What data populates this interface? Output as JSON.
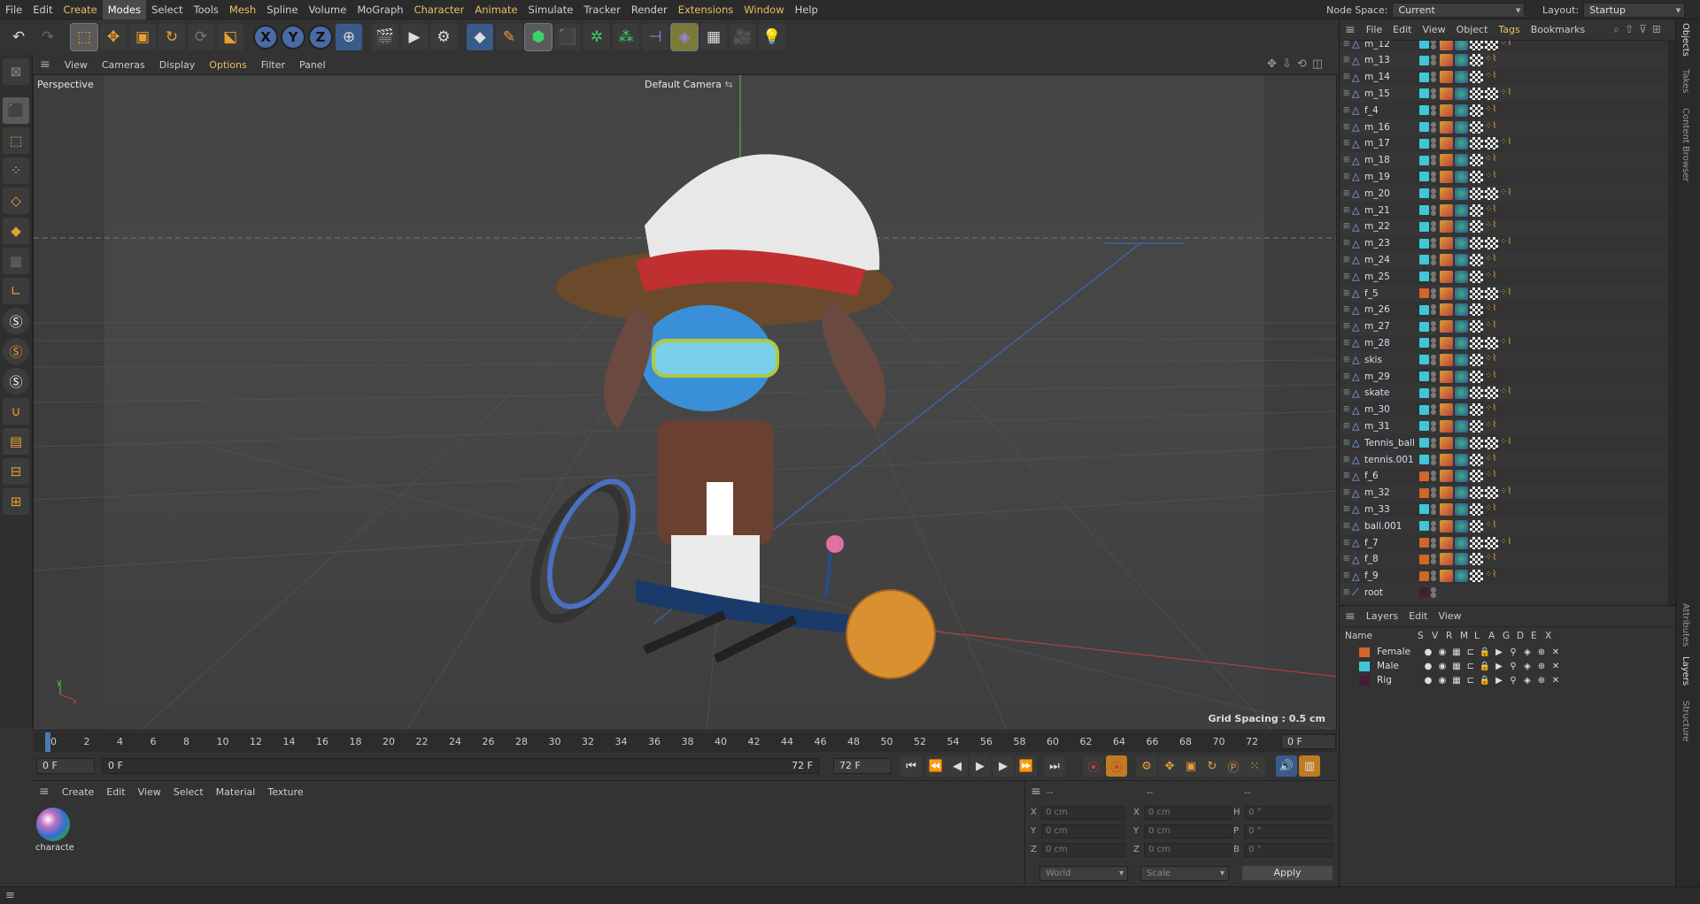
{
  "menubar": {
    "items": [
      "File",
      "Edit",
      "Create",
      "Modes",
      "Select",
      "Tools",
      "Mesh",
      "Spline",
      "Volume",
      "MoGraph",
      "Character",
      "Animate",
      "Simulate",
      "Tracker",
      "Render",
      "Extensions",
      "Window",
      "Help"
    ],
    "node_space_label": "Node Space:",
    "node_space_value": "Current (Standard/Physical)",
    "layout_label": "Layout:",
    "layout_value": "Startup"
  },
  "viewport": {
    "menu": [
      "View",
      "Cameras",
      "Display",
      "Options",
      "Filter",
      "Panel"
    ],
    "projection": "Perspective",
    "camera": "Default Camera",
    "grid_spacing": "Grid Spacing : 0.5 cm",
    "axis_y": "y",
    "axis_x": "x"
  },
  "timeline": {
    "ticks": [
      "0",
      "2",
      "4",
      "6",
      "8",
      "10",
      "12",
      "14",
      "16",
      "18",
      "20",
      "22",
      "24",
      "26",
      "28",
      "30",
      "32",
      "34",
      "36",
      "38",
      "40",
      "42",
      "44",
      "46",
      "48",
      "50",
      "52",
      "54",
      "56",
      "58",
      "60",
      "62",
      "64",
      "66",
      "68",
      "70",
      "72"
    ],
    "current_frame": "0 F",
    "start_frame": "0 F",
    "range_start": "0 F",
    "range_end": "72 F",
    "end_frame": "72 F"
  },
  "material_manager": {
    "menu": [
      "Create",
      "Edit",
      "View",
      "Select",
      "Material",
      "Texture"
    ],
    "material_name": "characte"
  },
  "coordinates": {
    "header_1": "--",
    "header_2": "--",
    "header_3": "--",
    "rows": [
      {
        "a": "X",
        "av": "0 cm",
        "b": "X",
        "bv": "0 cm",
        "c": "H",
        "cv": "0 °"
      },
      {
        "a": "Y",
        "av": "0 cm",
        "b": "Y",
        "bv": "0 cm",
        "c": "P",
        "cv": "0 °"
      },
      {
        "a": "Z",
        "av": "0 cm",
        "b": "Z",
        "bv": "0 cm",
        "c": "B",
        "cv": "0 °"
      }
    ],
    "mode": "World",
    "scale": "Scale",
    "apply": "Apply"
  },
  "object_manager": {
    "menu": [
      "File",
      "Edit",
      "View",
      "Object",
      "Tags",
      "Bookmarks"
    ],
    "objects": [
      {
        "name": "m_12",
        "color": "#3fc7d8"
      },
      {
        "name": "m_13",
        "color": "#3fc7d8"
      },
      {
        "name": "m_14",
        "color": "#3fc7d8"
      },
      {
        "name": "m_15",
        "color": "#3fc7d8"
      },
      {
        "name": "f_4",
        "color": "#3fc7d8"
      },
      {
        "name": "m_16",
        "color": "#3fc7d8"
      },
      {
        "name": "m_17",
        "color": "#3fc7d8"
      },
      {
        "name": "m_18",
        "color": "#3fc7d8"
      },
      {
        "name": "m_19",
        "color": "#3fc7d8"
      },
      {
        "name": "m_20",
        "color": "#3fc7d8"
      },
      {
        "name": "m_21",
        "color": "#3fc7d8"
      },
      {
        "name": "m_22",
        "color": "#3fc7d8"
      },
      {
        "name": "m_23",
        "color": "#3fc7d8"
      },
      {
        "name": "m_24",
        "color": "#3fc7d8"
      },
      {
        "name": "m_25",
        "color": "#3fc7d8"
      },
      {
        "name": "f_5",
        "color": "#d2662a"
      },
      {
        "name": "m_26",
        "color": "#3fc7d8"
      },
      {
        "name": "m_27",
        "color": "#3fc7d8"
      },
      {
        "name": "m_28",
        "color": "#3fc7d8"
      },
      {
        "name": "skis",
        "color": "#3fc7d8"
      },
      {
        "name": "m_29",
        "color": "#3fc7d8"
      },
      {
        "name": "skate",
        "color": "#3fc7d8"
      },
      {
        "name": "m_30",
        "color": "#3fc7d8"
      },
      {
        "name": "m_31",
        "color": "#3fc7d8"
      },
      {
        "name": "Tennis_ball",
        "color": "#3fc7d8"
      },
      {
        "name": "tennis.001",
        "color": "#3fc7d8"
      },
      {
        "name": "f_6",
        "color": "#d2662a"
      },
      {
        "name": "m_32",
        "color": "#d2662a"
      },
      {
        "name": "m_33",
        "color": "#3fc7d8"
      },
      {
        "name": "ball.001",
        "color": "#3fc7d8"
      },
      {
        "name": "f_7",
        "color": "#d2662a"
      },
      {
        "name": "f_8",
        "color": "#d2662a"
      },
      {
        "name": "f_9",
        "color": "#d2662a"
      },
      {
        "name": "root",
        "color": "#4a1a38"
      }
    ]
  },
  "layer_manager": {
    "menu": [
      "Layers",
      "Edit",
      "View"
    ],
    "columns": [
      "Name",
      "S",
      "V",
      "R",
      "M",
      "L",
      "A",
      "G",
      "D",
      "E",
      "X"
    ],
    "layers": [
      {
        "name": "Female",
        "color": "#d2662a"
      },
      {
        "name": "Male",
        "color": "#3fc7d8"
      },
      {
        "name": "Rig",
        "color": "#4a1a38"
      }
    ]
  },
  "side_tabs": [
    "Objects",
    "Takes",
    "Content Browser",
    "Attributes",
    "Layers",
    "Structure"
  ]
}
